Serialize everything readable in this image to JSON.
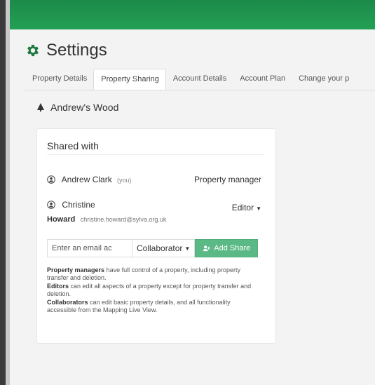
{
  "app": {
    "title": "Settings"
  },
  "tabs": [
    {
      "label": "Property Details",
      "active": false
    },
    {
      "label": "Property Sharing",
      "active": true
    },
    {
      "label": "Account Details",
      "active": false
    },
    {
      "label": "Account Plan",
      "active": false
    },
    {
      "label": "Change your p",
      "active": false
    }
  ],
  "property": {
    "name": "Andrew's Wood"
  },
  "sharing": {
    "heading": "Shared with",
    "users": [
      {
        "name": "Andrew Clark",
        "suffix": "(you)",
        "role": "Property manager"
      },
      {
        "first_name": "Christine",
        "last_name": "Howard",
        "email": "christine.howard@sylva.org.uk",
        "role": "Editor"
      }
    ],
    "email_placeholder": "Enter an email ac",
    "role_select": "Collaborator",
    "add_button": "Add Share",
    "help": [
      {
        "term": "Property managers",
        "text": "have full control of a property, including property transfer and deletion."
      },
      {
        "term": "Editors",
        "text": "can edit all aspects of a property except for property transfer and deletion."
      },
      {
        "term": "Collaborators",
        "text": "can edit basic property details, and all functionality accessible from the Mapping Live View."
      }
    ]
  },
  "colors": {
    "header_green": "#1c8a4a",
    "button_green": "#5bb985",
    "gear_green": "#1e7a3e"
  }
}
